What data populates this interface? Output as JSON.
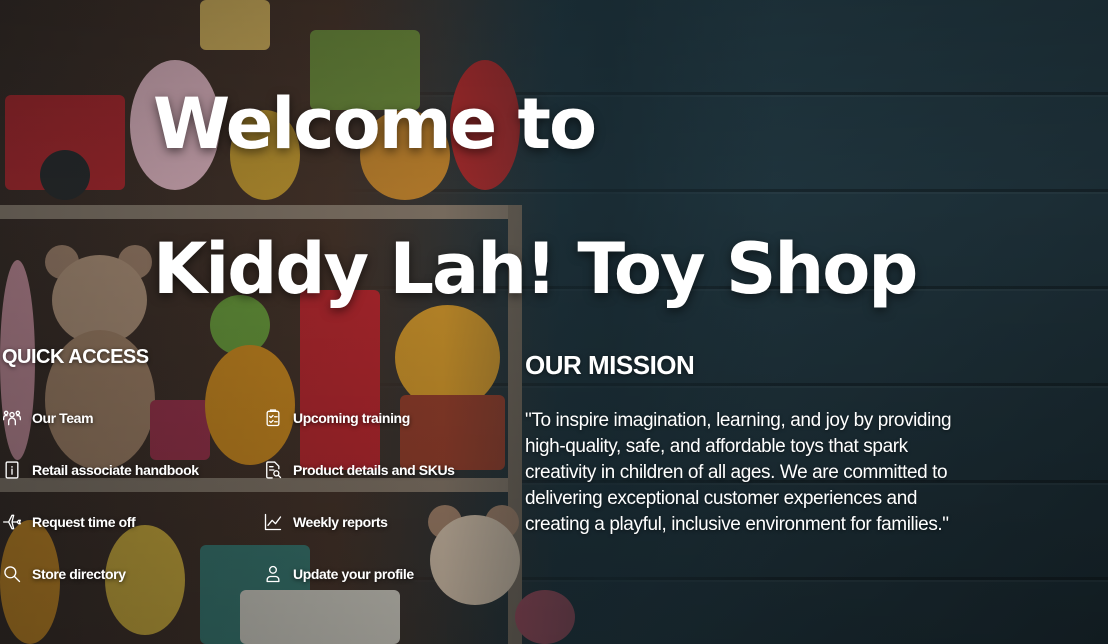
{
  "hero": {
    "title_line1": "Welcome to",
    "title_line2": "Kiddy Lah! Toy Shop"
  },
  "quick_access": {
    "heading": "QUICK ACCESS",
    "items": [
      {
        "label": "Our Team",
        "icon": "team-icon"
      },
      {
        "label": "Upcoming training",
        "icon": "checklist-icon"
      },
      {
        "label": "Retail associate handbook",
        "icon": "handbook-icon"
      },
      {
        "label": "Product details and SKUs",
        "icon": "document-search-icon"
      },
      {
        "label": "Request time off",
        "icon": "airplane-icon"
      },
      {
        "label": "Weekly reports",
        "icon": "line-chart-icon"
      },
      {
        "label": "Store directory",
        "icon": "search-icon"
      },
      {
        "label": "Update your profile",
        "icon": "person-icon"
      }
    ]
  },
  "mission": {
    "heading": "OUR MISSION",
    "text": "\"To inspire imagination, learning, and joy by providing high-quality, safe, and affordable toys that spark creativity in children of all ages. We are committed to delivering exceptional customer experiences and creating a playful, inclusive environment for families.\""
  },
  "colors": {
    "text": "#ffffff",
    "background": "#223a44"
  }
}
